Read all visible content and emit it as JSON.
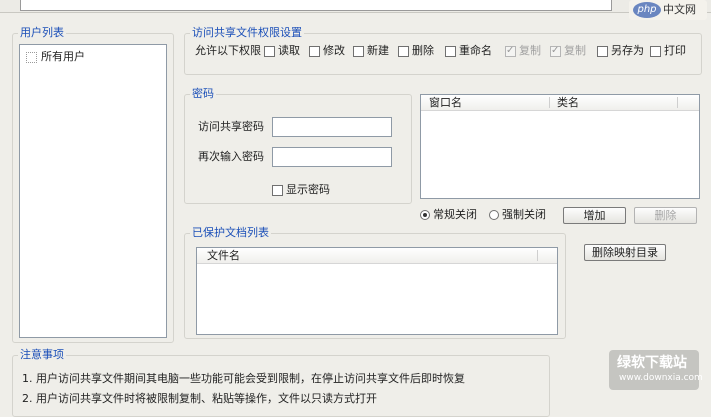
{
  "user_list": {
    "legend": "用户列表",
    "root_item": "所有用户"
  },
  "permissions": {
    "legend": "访问共享文件权限设置",
    "prompt": "允许以下权限",
    "items": [
      {
        "label": "读取",
        "checked": false,
        "disabled": false
      },
      {
        "label": "修改",
        "checked": false,
        "disabled": false
      },
      {
        "label": "新建",
        "checked": false,
        "disabled": false
      },
      {
        "label": "删除",
        "checked": false,
        "disabled": false
      },
      {
        "label": "重命名",
        "checked": false,
        "disabled": false
      },
      {
        "label": "复制",
        "checked": true,
        "disabled": true
      },
      {
        "label": "复制",
        "checked": true,
        "disabled": true
      },
      {
        "label": "另存为",
        "checked": false,
        "disabled": false
      },
      {
        "label": "打印",
        "checked": false,
        "disabled": false
      }
    ]
  },
  "password": {
    "legend": "密码",
    "access_label": "访问共享密码",
    "access_value": "",
    "confirm_label": "再次输入密码",
    "confirm_value": "",
    "show_label": "显示密码"
  },
  "window_table": {
    "col_window": "窗口名",
    "col_class": "类名"
  },
  "close_mode": {
    "normal": "常规关闭",
    "force": "强制关闭",
    "selected": "normal"
  },
  "buttons": {
    "add": "增加",
    "remove": "删除",
    "delete_map": "删除映射目录"
  },
  "protected_docs": {
    "legend": "已保护文档列表",
    "col_filename": "文件名"
  },
  "notes": {
    "legend": "注意事项",
    "line1": "1. 用户访问共享文件期间其电脑一些功能可能会受到限制，在停止访问共享文件后即时恢复",
    "line2": "2. 用户访问共享文件时将被限制复制、粘贴等操作，文件以只读方式打开"
  },
  "logo": {
    "badge": "php",
    "text": "中文网"
  },
  "watermark": {
    "title": "绿软下载站",
    "sub": "www.downxia.com"
  }
}
